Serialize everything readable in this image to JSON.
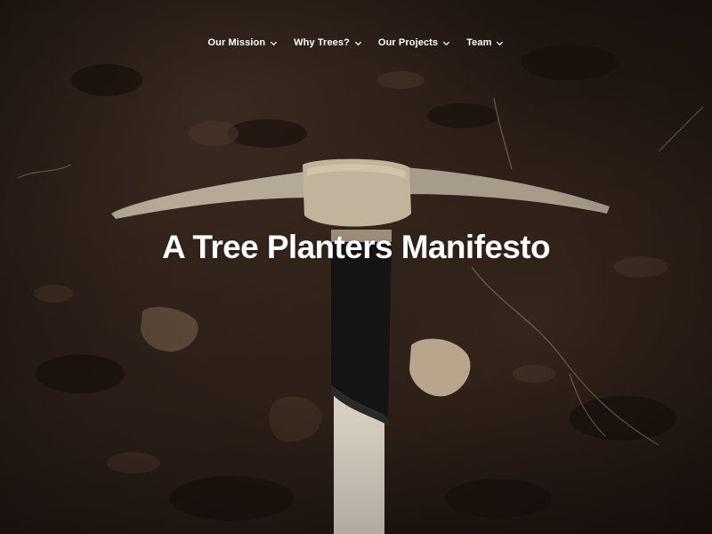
{
  "nav": {
    "items": [
      {
        "label": "Our Mission",
        "icon": "chevron-down-icon"
      },
      {
        "label": "Why Trees?",
        "icon": "chevron-down-icon"
      },
      {
        "label": "Our Projects",
        "icon": "chevron-down-icon"
      },
      {
        "label": "Team",
        "icon": "chevron-down-icon"
      }
    ]
  },
  "hero": {
    "title": "A Tree Planters Manifesto",
    "image": "pickaxe-on-soil-photo"
  },
  "colors": {
    "text": "#ffffff",
    "soil": "#2a1d16",
    "pickaxe_head": "#b5aa98",
    "handle_grip": "#141414",
    "handle_wood": "#d8d1c3"
  }
}
